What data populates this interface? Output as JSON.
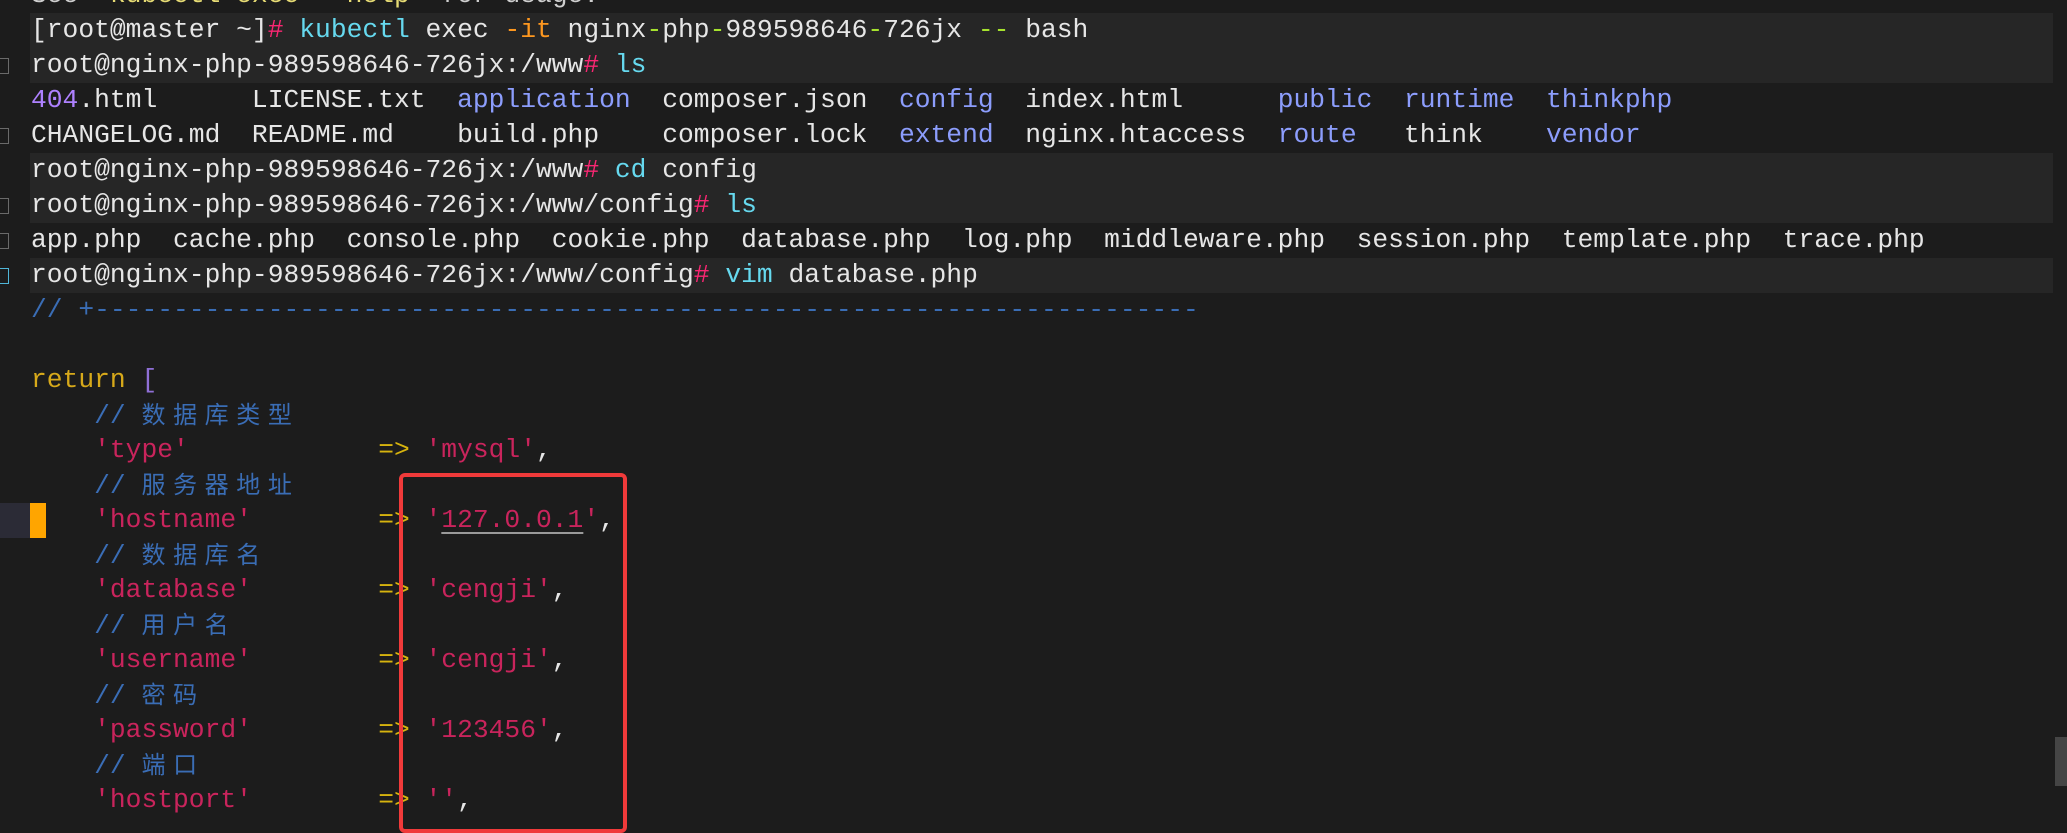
{
  "terminal": {
    "lines": [
      [
        {
          "t": "See ",
          "c": "faded"
        },
        {
          "t": "'kubectl exec --help'",
          "c": "yel"
        },
        {
          "t": " for usage.",
          "c": "faded"
        }
      ],
      [
        {
          "t": "[root@master ~]",
          "c": "def"
        },
        {
          "t": "#",
          "c": "hash"
        },
        {
          "t": " ",
          "c": "def"
        },
        {
          "t": "kubectl",
          "c": "cmd"
        },
        {
          "t": " exec ",
          "c": "def"
        },
        {
          "t": "-it",
          "c": "opt"
        },
        {
          "t": " nginx",
          "c": "def"
        },
        {
          "t": "-",
          "c": "dash"
        },
        {
          "t": "php",
          "c": "def"
        },
        {
          "t": "-",
          "c": "dash"
        },
        {
          "t": "989598646",
          "c": "def"
        },
        {
          "t": "-",
          "c": "dash"
        },
        {
          "t": "726jx ",
          "c": "def"
        },
        {
          "t": "--",
          "c": "dash"
        },
        {
          "t": " bash",
          "c": "def"
        }
      ],
      [
        {
          "t": "root@nginx-php-989598646-726jx:/www",
          "c": "def"
        },
        {
          "t": "#",
          "c": "hash"
        },
        {
          "t": " ",
          "c": "def"
        },
        {
          "t": "ls",
          "c": "cmd"
        }
      ],
      [
        {
          "t": "404",
          "c": "num"
        },
        {
          "t": ".html      LICENSE.txt  ",
          "c": "def"
        },
        {
          "t": "application",
          "c": "dir"
        },
        {
          "t": "  composer.json  ",
          "c": "def"
        },
        {
          "t": "config",
          "c": "dir"
        },
        {
          "t": "  index.html      ",
          "c": "def"
        },
        {
          "t": "public",
          "c": "dir"
        },
        {
          "t": "  ",
          "c": "def"
        },
        {
          "t": "runtime",
          "c": "dir"
        },
        {
          "t": "  ",
          "c": "def"
        },
        {
          "t": "thinkphp",
          "c": "dir"
        }
      ],
      [
        {
          "t": "CHANGELOG.md  README.md    build.php    composer.lock  ",
          "c": "def"
        },
        {
          "t": "extend",
          "c": "dir"
        },
        {
          "t": "  nginx.htaccess  ",
          "c": "def"
        },
        {
          "t": "route",
          "c": "dir"
        },
        {
          "t": "   think    ",
          "c": "def"
        },
        {
          "t": "vendor",
          "c": "dir"
        }
      ],
      [
        {
          "t": "root@nginx-php-989598646-726jx:/www",
          "c": "def"
        },
        {
          "t": "#",
          "c": "hash"
        },
        {
          "t": " ",
          "c": "def"
        },
        {
          "t": "cd",
          "c": "cmd"
        },
        {
          "t": " config",
          "c": "def"
        }
      ],
      [
        {
          "t": "root@nginx-php-989598646-726jx:/www/config",
          "c": "def"
        },
        {
          "t": "#",
          "c": "hash"
        },
        {
          "t": " ",
          "c": "def"
        },
        {
          "t": "ls",
          "c": "cmd"
        }
      ],
      [
        {
          "t": "app.php  cache.php  console.php  cookie.php  database.php  log.php  middleware.php  session.php  template.php  trace.php",
          "c": "def"
        }
      ],
      [
        {
          "t": "root@nginx-php-989598646-726jx:/www/config",
          "c": "def"
        },
        {
          "t": "#",
          "c": "hash"
        },
        {
          "t": " ",
          "c": "def"
        },
        {
          "t": "vim",
          "c": "cmd"
        },
        {
          "t": " database.php",
          "c": "def"
        }
      ],
      [
        {
          "t": "// +----------------------------------------------------------------------",
          "c": "cmt"
        }
      ],
      [],
      [
        {
          "t": "return ",
          "c": "kw"
        },
        {
          "t": "[",
          "c": "br"
        }
      ],
      [
        {
          "t": "    // ",
          "c": "cmt"
        },
        {
          "t": "数据库类型",
          "c": "cmt",
          "cjk": true
        }
      ],
      [
        {
          "t": "    'type'",
          "c": "str"
        },
        {
          "t": "            ",
          "c": "def"
        },
        {
          "t": "=>",
          "c": "op"
        },
        {
          "t": " ",
          "c": "def"
        },
        {
          "t": "'mysql'",
          "c": "str"
        },
        {
          "t": ",",
          "c": "def"
        }
      ],
      [
        {
          "t": "    // ",
          "c": "cmt"
        },
        {
          "t": "服务器地址",
          "c": "cmt",
          "cjk": true
        }
      ],
      [
        {
          "t": "    'hostname'",
          "c": "str"
        },
        {
          "t": "        ",
          "c": "def"
        },
        {
          "t": "=>",
          "c": "op"
        },
        {
          "t": " '",
          "c": "str"
        },
        {
          "t": "127.0.0.1",
          "c": "und"
        },
        {
          "t": "'",
          "c": "str"
        },
        {
          "t": ",",
          "c": "def"
        }
      ],
      [
        {
          "t": "    // ",
          "c": "cmt"
        },
        {
          "t": "数据库名",
          "c": "cmt",
          "cjk": true
        }
      ],
      [
        {
          "t": "    'database'",
          "c": "str"
        },
        {
          "t": "        ",
          "c": "def"
        },
        {
          "t": "=>",
          "c": "op"
        },
        {
          "t": " ",
          "c": "def"
        },
        {
          "t": "'cengji'",
          "c": "str"
        },
        {
          "t": ",",
          "c": "def"
        }
      ],
      [
        {
          "t": "    // ",
          "c": "cmt"
        },
        {
          "t": "用户名",
          "c": "cmt",
          "cjk": true
        }
      ],
      [
        {
          "t": "    'username'",
          "c": "str"
        },
        {
          "t": "        ",
          "c": "def"
        },
        {
          "t": "=>",
          "c": "op"
        },
        {
          "t": " ",
          "c": "def"
        },
        {
          "t": "'cengji'",
          "c": "str"
        },
        {
          "t": ",",
          "c": "def"
        }
      ],
      [
        {
          "t": "    // ",
          "c": "cmt"
        },
        {
          "t": "密码",
          "c": "cmt",
          "cjk": true
        }
      ],
      [
        {
          "t": "    'password'",
          "c": "str"
        },
        {
          "t": "        ",
          "c": "def"
        },
        {
          "t": "=>",
          "c": "op"
        },
        {
          "t": " ",
          "c": "def"
        },
        {
          "t": "'123456'",
          "c": "str"
        },
        {
          "t": ",",
          "c": "def"
        }
      ],
      [
        {
          "t": "    // ",
          "c": "cmt"
        },
        {
          "t": "端口",
          "c": "cmt",
          "cjk": true
        }
      ],
      [
        {
          "t": "    'hostport'",
          "c": "str"
        },
        {
          "t": "        ",
          "c": "def"
        },
        {
          "t": "=>",
          "c": "op"
        },
        {
          "t": " ",
          "c": "def"
        },
        {
          "t": "''",
          "c": "str"
        },
        {
          "t": ",",
          "c": "def"
        }
      ]
    ],
    "highlighted_rows": [
      1,
      2,
      5,
      6,
      8
    ],
    "gutter_marks": [
      2,
      4,
      6,
      7,
      8
    ],
    "cursor_row": 15
  },
  "colors": {
    "background": "#1c1c1c",
    "highlight": "#262626",
    "annotation_box": "#f03a3a",
    "cursor": "#ffa500"
  }
}
